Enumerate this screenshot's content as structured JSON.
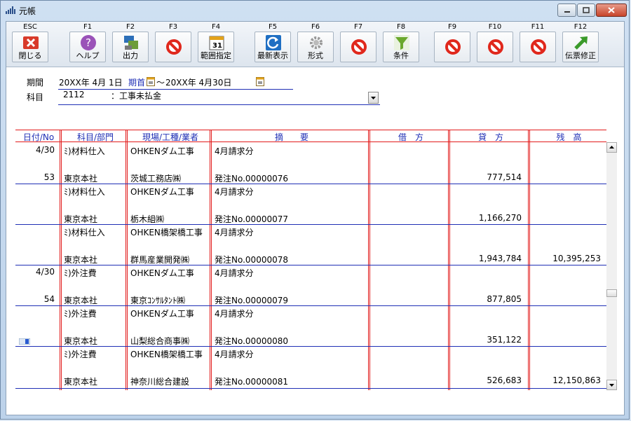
{
  "window": {
    "title": "元帳"
  },
  "toolbar": {
    "keys": [
      {
        "key": "ESC",
        "label": "閉じる",
        "icon": "close-x-icon"
      },
      {
        "key": "F1",
        "label": "ヘルプ",
        "icon": "help-icon"
      },
      {
        "key": "F2",
        "label": "出力",
        "icon": "output-icon"
      },
      {
        "key": "F3",
        "label": "",
        "icon": "prohibited-icon"
      },
      {
        "key": "F4",
        "label": "範囲指定",
        "icon": "calendar-icon"
      },
      {
        "key": "F5",
        "label": "最新表示",
        "icon": "refresh-icon"
      },
      {
        "key": "F6",
        "label": "形式",
        "icon": "gear-icon"
      },
      {
        "key": "F7",
        "label": "",
        "icon": "prohibited-icon"
      },
      {
        "key": "F8",
        "label": "条件",
        "icon": "filter-icon"
      },
      {
        "key": "F9",
        "label": "",
        "icon": "prohibited-icon"
      },
      {
        "key": "F10",
        "label": "",
        "icon": "prohibited-icon"
      },
      {
        "key": "F11",
        "label": "",
        "icon": "prohibited-icon"
      },
      {
        "key": "F12",
        "label": "伝票修正",
        "icon": "arrow-up-right-icon"
      }
    ]
  },
  "filters": {
    "period_label": "期間",
    "period_start": "20XX年 4月 1日",
    "period_start_mode": "期首",
    "period_range_sep": "〜",
    "period_end": "20XX年 4月30日",
    "account_label": "科目",
    "account_code": "2112",
    "account_name": "：工事未払金"
  },
  "grid": {
    "headers": [
      "日付/No",
      "科目/部門",
      "現場/工種/業者",
      "摘　　要",
      "借　方",
      "貸　方",
      "残　高"
    ],
    "rows": [
      {
        "date": "4/30",
        "no": "53",
        "account": "ﾐ)材料仕入",
        "dept": "東京本社",
        "site": "OHKENダム工事",
        "vendor": "茨城工務店㈱",
        "desc1": "4月請求分",
        "desc2": "発注No.00000076",
        "debit": "",
        "credit": "777,514",
        "balance": ""
      },
      {
        "date": "",
        "no": "",
        "account": "ﾐ)材料仕入",
        "dept": "東京本社",
        "site": "OHKENダム工事",
        "vendor": "栃木組㈱",
        "desc1": "4月請求分",
        "desc2": "発注No.00000077",
        "debit": "",
        "credit": "1,166,270",
        "balance": ""
      },
      {
        "date": "",
        "no": "",
        "account": "ﾐ)材料仕入",
        "dept": "東京本社",
        "site": "OHKEN橋架橋工事",
        "vendor": "群馬産業開発㈱",
        "desc1": "4月請求分",
        "desc2": "発注No.00000078",
        "debit": "",
        "credit": "1,943,784",
        "balance": "10,395,253"
      },
      {
        "date": "4/30",
        "no": "54",
        "account": "ﾐ)外注費",
        "dept": "東京本社",
        "site": "OHKENダム工事",
        "vendor": "東京ｺﾝｻﾙﾀﾝﾄ㈱",
        "desc1": "4月請求分",
        "desc2": "発注No.00000079",
        "debit": "",
        "credit": "877,805",
        "balance": ""
      },
      {
        "date": "",
        "no": "",
        "account": "ﾐ)外注費",
        "dept": "東京本社",
        "site": "OHKENダム工事",
        "vendor": "山梨総合商事㈱",
        "desc1": "4月請求分",
        "desc2": "発注No.00000080",
        "debit": "",
        "credit": "351,122",
        "balance": ""
      },
      {
        "date": "",
        "no": "",
        "account": "ﾐ)外注費",
        "dept": "東京本社",
        "site": "OHKEN橋架橋工事",
        "vendor": "神奈川総合建設",
        "desc1": "4月請求分",
        "desc2": "発注No.00000081",
        "debit": "",
        "credit": "526,683",
        "balance": "12,150,863"
      }
    ]
  }
}
